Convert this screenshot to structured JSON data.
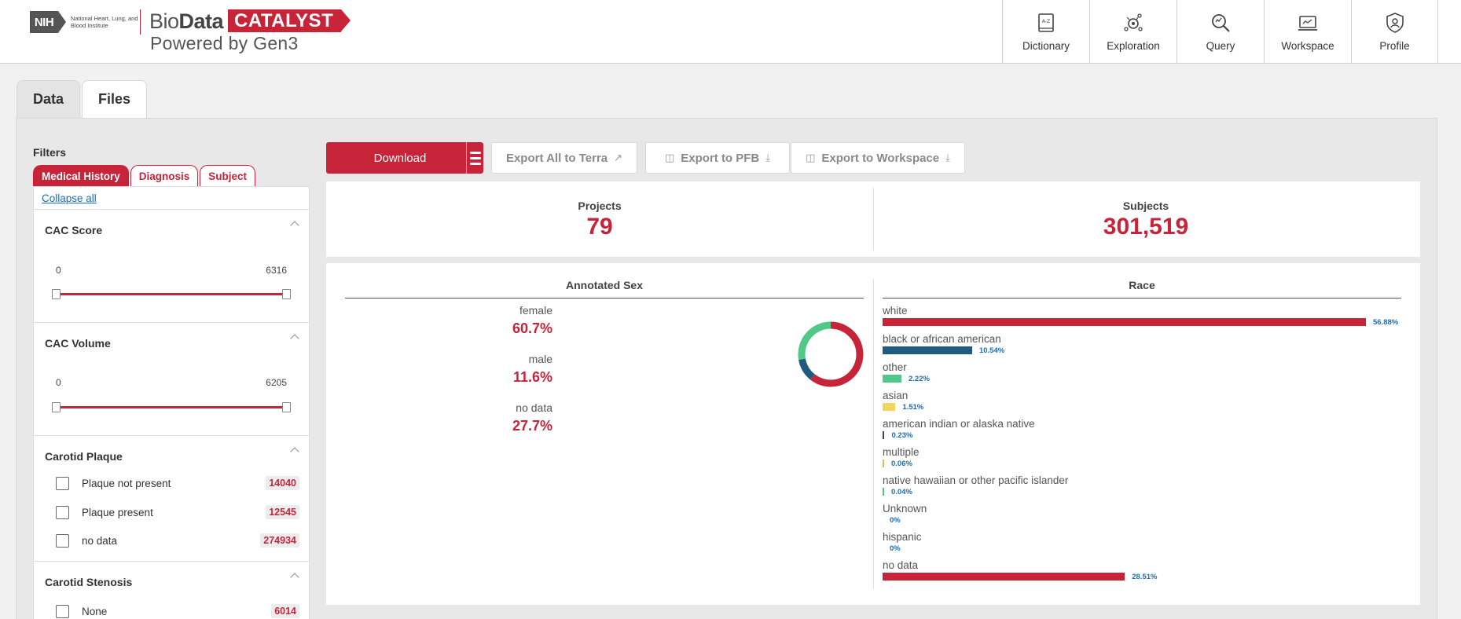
{
  "header": {
    "nih_abbr": "NIH",
    "nih_institute": "National Heart, Lung, and Blood Institute",
    "brand_bio": "Bio",
    "brand_data": "Data",
    "brand_catalyst": "CATALYST",
    "brand_powered": "Powered by Gen3",
    "nav": [
      {
        "label": "Dictionary",
        "icon": "dictionary-icon"
      },
      {
        "label": "Exploration",
        "icon": "exploration-icon"
      },
      {
        "label": "Query",
        "icon": "query-icon"
      },
      {
        "label": "Workspace",
        "icon": "workspace-icon"
      },
      {
        "label": "Profile",
        "icon": "profile-icon"
      }
    ]
  },
  "tabs": [
    {
      "label": "Data",
      "active": false
    },
    {
      "label": "Files",
      "active": true
    }
  ],
  "filters": {
    "title": "Filters",
    "tabs": [
      "Medical History",
      "Diagnosis",
      "Subject"
    ],
    "collapse_all": "Collapse all",
    "cac_score": {
      "title": "CAC Score",
      "min": "0",
      "max": "6316"
    },
    "cac_volume": {
      "title": "CAC Volume",
      "min": "0",
      "max": "6205"
    },
    "carotid_plaque": {
      "title": "Carotid Plaque",
      "options": [
        {
          "label": "Plaque not present",
          "count": "14040"
        },
        {
          "label": "Plaque present",
          "count": "12545"
        },
        {
          "label": "no data",
          "count": "274934"
        }
      ]
    },
    "carotid_stenosis": {
      "title": "Carotid Stenosis",
      "options": [
        {
          "label": "None",
          "count": "6014"
        }
      ]
    }
  },
  "actions": {
    "download": "Download",
    "export_terra": "Export All to Terra",
    "export_pfb": "Export to PFB",
    "export_workspace": "Export to Workspace"
  },
  "summary": {
    "projects_label": "Projects",
    "projects_value": "79",
    "subjects_label": "Subjects",
    "subjects_value": "301,519"
  },
  "colors": {
    "brand_red": "#c7243a",
    "navy": "#1f5b80",
    "green": "#4fc888",
    "yellow": "#f2d55b",
    "link_blue": "#1a6eb5"
  },
  "chart_data": [
    {
      "type": "pie",
      "title": "Annotated Sex",
      "categories": [
        "female",
        "male",
        "no data"
      ],
      "labels": [
        "60.7%",
        "11.6%",
        "27.7%"
      ],
      "values": [
        60.7,
        11.6,
        27.7
      ],
      "colors": [
        "#c7243a",
        "#1f5b80",
        "#4fc888"
      ]
    },
    {
      "type": "bar",
      "title": "Race",
      "categories": [
        "white",
        "black or african american",
        "other",
        "asian",
        "american indian or alaska native",
        "multiple",
        "native hawaiian or other pacific islander",
        "Unknown",
        "hispanic",
        "no data"
      ],
      "labels": [
        "56.88%",
        "10.54%",
        "2.22%",
        "1.51%",
        "0.23%",
        "0.06%",
        "0.04%",
        "0%",
        "0%",
        "28.51%"
      ],
      "values": [
        56.88,
        10.54,
        2.22,
        1.51,
        0.23,
        0.06,
        0.04,
        0,
        0,
        28.51
      ],
      "colors": [
        "#c7243a",
        "#1f5b80",
        "#4fc888",
        "#f2d55b",
        "#3a3f73",
        "#e8b84c",
        "#4fc888",
        "#1f5b80",
        "#c7243a",
        "#c7243a"
      ]
    }
  ]
}
